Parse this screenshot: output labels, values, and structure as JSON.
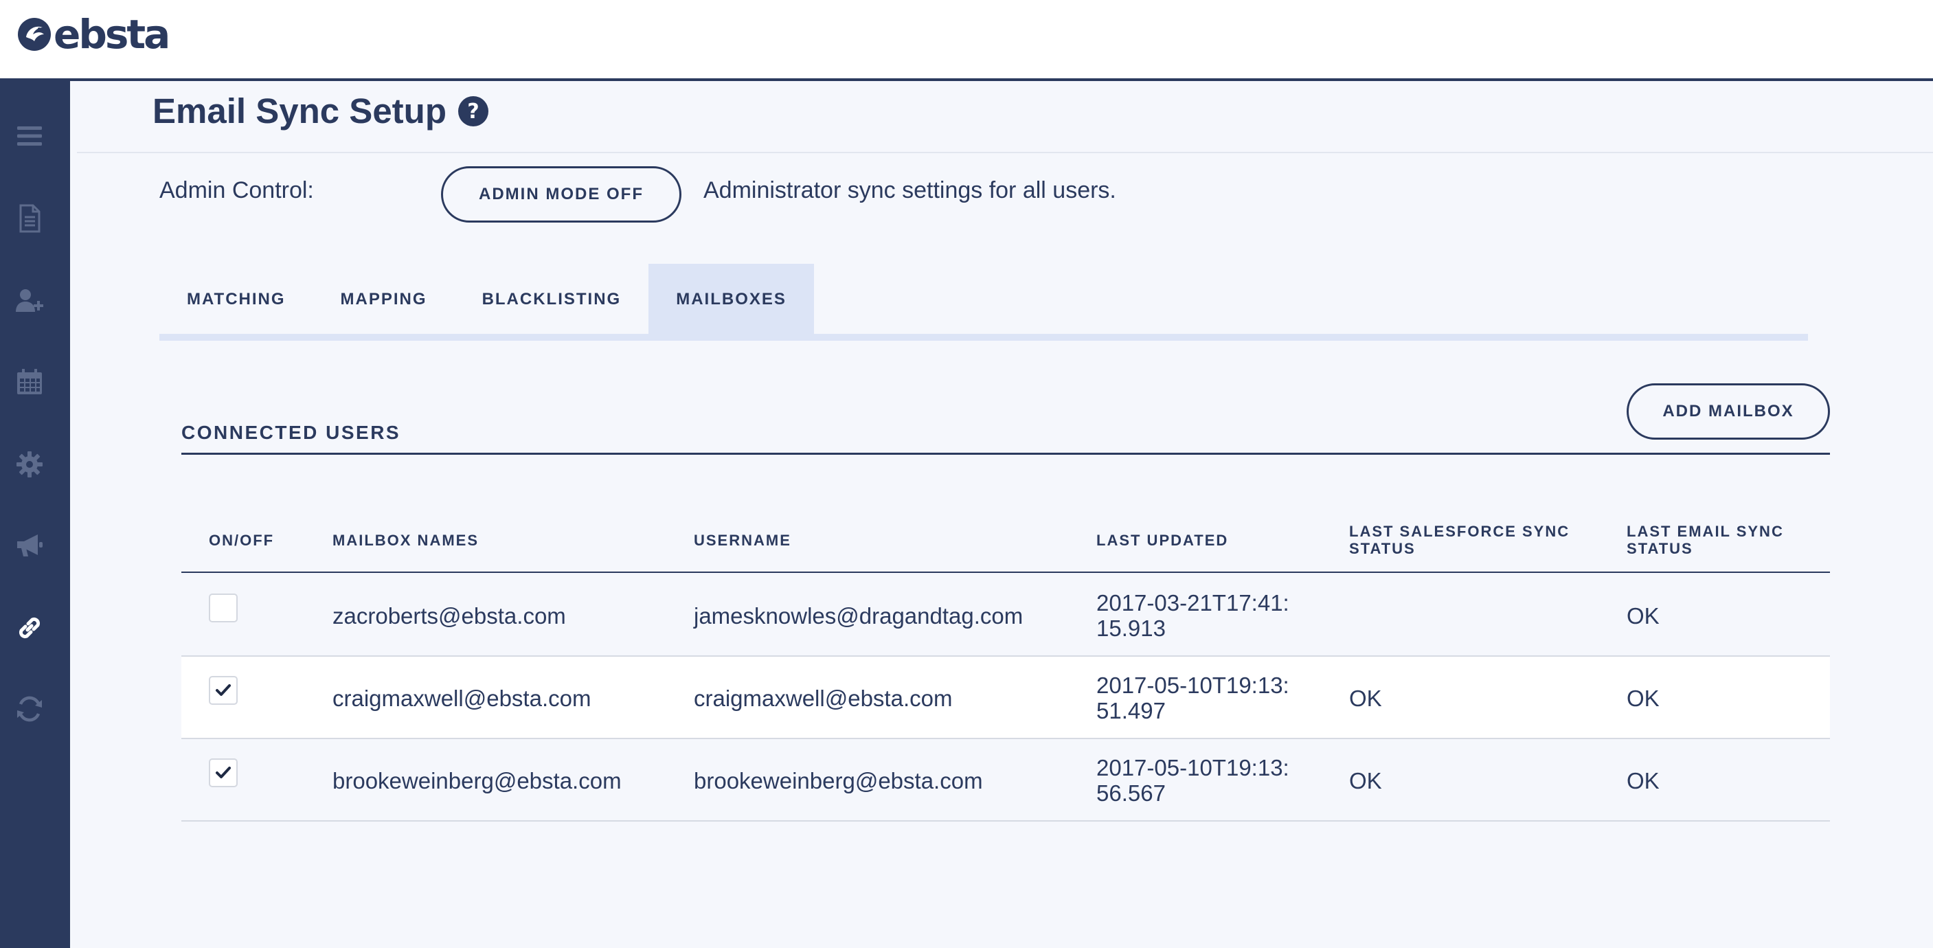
{
  "header": {
    "logo_text": "ebsta"
  },
  "sidebar": {
    "items": [
      {
        "icon": "menu-icon"
      },
      {
        "icon": "document-icon"
      },
      {
        "icon": "add-user-icon"
      },
      {
        "icon": "calendar-icon"
      },
      {
        "icon": "gear-icon"
      },
      {
        "icon": "megaphone-icon"
      },
      {
        "icon": "link-icon",
        "active": true
      },
      {
        "icon": "sync-icon"
      }
    ]
  },
  "page": {
    "title": "Email Sync Setup",
    "admin_label": "Admin Control:",
    "admin_button": "ADMIN MODE OFF",
    "admin_description": "Administrator sync settings for all users."
  },
  "tabs": [
    {
      "label": "MATCHING",
      "active": false
    },
    {
      "label": "MAPPING",
      "active": false
    },
    {
      "label": "BLACKLISTING",
      "active": false
    },
    {
      "label": "MAILBOXES",
      "active": true
    }
  ],
  "section": {
    "title": "CONNECTED USERS",
    "add_button": "ADD MAILBOX"
  },
  "table": {
    "columns": [
      "ON/OFF",
      "MAILBOX NAMES",
      "USERNAME",
      "LAST UPDATED",
      "LAST SALESFORCE SYNC STATUS",
      "LAST EMAIL SYNC STATUS"
    ],
    "rows": [
      {
        "enabled": false,
        "mailbox": "zacroberts@ebsta.com",
        "username": "jamesknowles@dragandtag.com",
        "last_updated": "2017-03-21T17:41:15.913",
        "salesforce_status": "",
        "email_status": "OK"
      },
      {
        "enabled": true,
        "mailbox": "craigmaxwell@ebsta.com",
        "username": "craigmaxwell@ebsta.com",
        "last_updated": "2017-05-10T19:13:51.497",
        "salesforce_status": "OK",
        "email_status": "OK"
      },
      {
        "enabled": true,
        "mailbox": "brookeweinberg@ebsta.com",
        "username": "brookeweinberg@ebsta.com",
        "last_updated": "2017-05-10T19:13:56.567",
        "salesforce_status": "OK",
        "email_status": "OK"
      }
    ]
  },
  "colors": {
    "navy": "#2b3a5e",
    "active_tab": "#dce4f6",
    "background": "#f5f7fc"
  }
}
